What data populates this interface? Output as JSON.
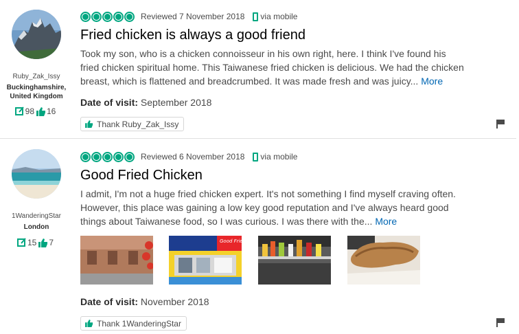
{
  "colors": {
    "accent": "#00a680",
    "link": "#0066b3",
    "text": "#4a4a4a",
    "title": "#000000"
  },
  "reviews": [
    {
      "username": "Ruby_Zak_Issy",
      "location": "Buckinghamshire, United Kingdom",
      "contributions": "98",
      "helpful_votes": "16",
      "rating": 5,
      "reviewed": "Reviewed 7 November 2018",
      "via": "via mobile",
      "title": "Fried chicken is always a good friend",
      "body": "Took my son, who is a chicken connoisseur in his own right, here. I think I've found his fried chicken spiritual home. This Taiwanese fried chicken is delicious. We had the chicken breast, which is flattened and breadcrumbed. It was made fresh and was juicy...",
      "more_label": "More",
      "visit_label": "Date of visit:",
      "visit_date": "September 2018",
      "thank_label": "Thank Ruby_Zak_Issy"
    },
    {
      "username": "1WanderingStar",
      "location": "London",
      "contributions": "15",
      "helpful_votes": "7",
      "rating": 5,
      "reviewed": "Reviewed 6 November 2018",
      "via": "via mobile",
      "title": "Good Fried Chicken",
      "body": "I admit, I'm not a huge fried chicken expert. It's not something I find myself craving often. However, this place was gaining a low key good reputation and I've always heard good things about Taiwanese food, so I was curious. I was there with the...",
      "more_label": "More",
      "photos": [
        "photo-street-building",
        "photo-shop-front",
        "photo-shelf-bottles",
        "photo-fried-chicken"
      ],
      "photo_sign_text": "Good Friend",
      "visit_label": "Date of visit:",
      "visit_date": "November 2018",
      "thank_label": "Thank 1WanderingStar"
    }
  ]
}
